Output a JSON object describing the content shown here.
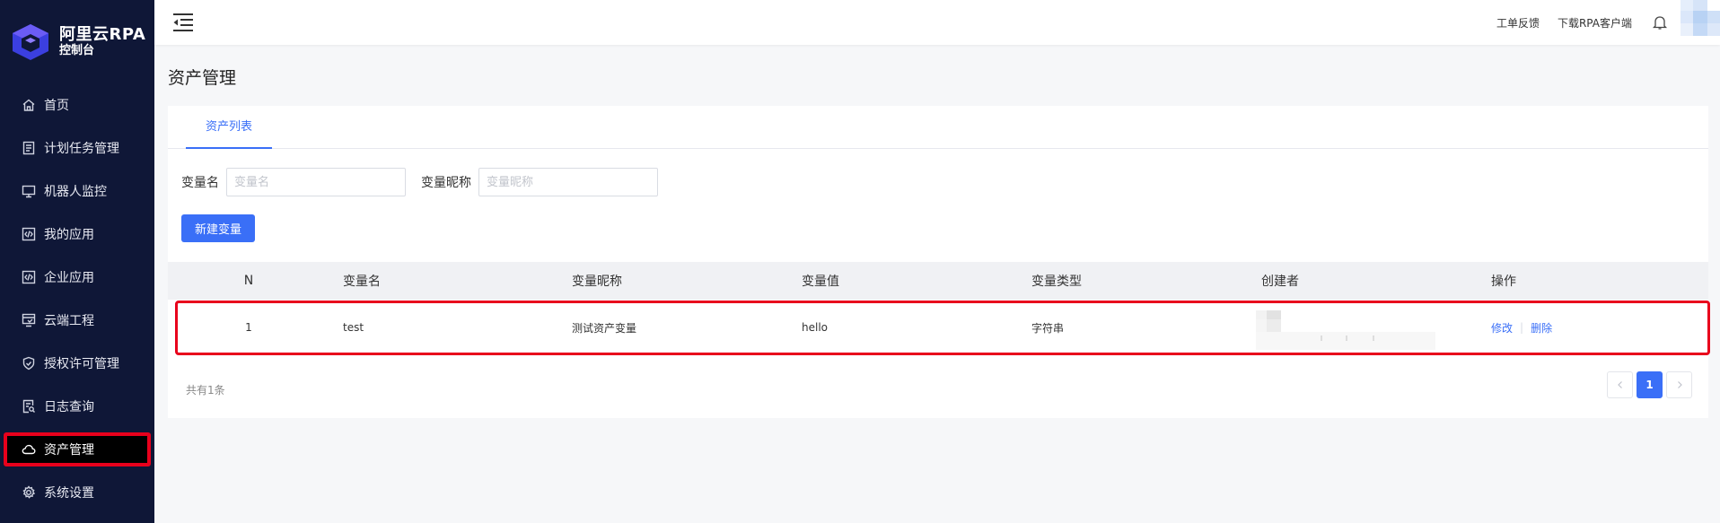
{
  "brand": {
    "title": "阿里云RPA",
    "subtitle": "控制台",
    "accent": "#3a6ff7"
  },
  "sidebar": {
    "items": [
      {
        "label": "首页",
        "icon": "home-icon"
      },
      {
        "label": "计划任务管理",
        "icon": "list-icon"
      },
      {
        "label": "机器人监控",
        "icon": "monitor-icon"
      },
      {
        "label": "我的应用",
        "icon": "code-icon"
      },
      {
        "label": "企业应用",
        "icon": "code-icon"
      },
      {
        "label": "云端工程",
        "icon": "cloud-project-icon"
      },
      {
        "label": "授权许可管理",
        "icon": "shield-icon"
      },
      {
        "label": "日志查询",
        "icon": "log-search-icon"
      },
      {
        "label": "资产管理",
        "icon": "cloud-icon",
        "active": true
      },
      {
        "label": "系统设置",
        "icon": "gear-icon"
      }
    ]
  },
  "header": {
    "feedback": "工单反馈",
    "download": "下载RPA客户端"
  },
  "page": {
    "title": "资产管理"
  },
  "tabs": [
    {
      "label": "资产列表",
      "active": true
    }
  ],
  "filters": {
    "var_name": {
      "label": "变量名",
      "placeholder": "变量名",
      "value": ""
    },
    "var_nick": {
      "label": "变量昵称",
      "placeholder": "变量昵称",
      "value": ""
    }
  },
  "actions": {
    "new_variable": "新建变量"
  },
  "table": {
    "columns": [
      "N",
      "变量名",
      "变量昵称",
      "变量值",
      "变量类型",
      "创建者",
      "操作"
    ],
    "rows": [
      {
        "n": "1",
        "name": "test",
        "nick": "测试资产变量",
        "value": "hello",
        "type": "字符串",
        "creator": "",
        "edit": "修改",
        "delete": "删除"
      }
    ]
  },
  "pagination": {
    "total": "共有1条",
    "current_page": "1"
  }
}
